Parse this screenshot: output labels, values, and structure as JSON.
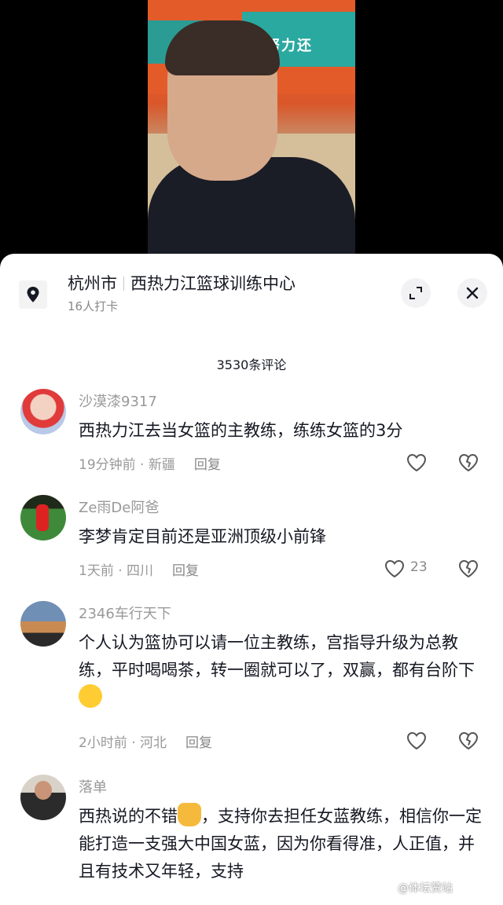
{
  "location": {
    "city": "杭州市",
    "place": "西热力江篮球训练中心",
    "checkins": "16人打卡"
  },
  "video": {
    "banner_text": "努力还"
  },
  "comments_header": {
    "count_label": "3530条评论"
  },
  "comments": [
    {
      "username": "沙漠漆9317",
      "text": "西热力江去当女篮的主教练，练练女篮的3分",
      "time": "19分钟前",
      "region": "新疆",
      "reply": "回复",
      "likes": ""
    },
    {
      "username": "Ze雨De阿爸",
      "text": "李梦肯定目前还是亚洲顶级小前锋",
      "time": "1天前",
      "region": "四川",
      "reply": "回复",
      "likes": "23"
    },
    {
      "username": "2346车行天下",
      "text": "个人认为篮协可以请一位主教练，宫指导升级为总教练，平时喝喝茶，转一圈就可以了，双赢，都有台阶下",
      "time": "2小时前",
      "region": "河北",
      "reply": "回复",
      "likes": ""
    },
    {
      "username": "落单",
      "text_a": "西热说的不错",
      "text_b": "，支持你去担任女蓝教练，相信你一定能打造一支强大中国女蓝，因为你看得准，人正值，并且有技术又年轻，支持",
      "time": "",
      "region": "",
      "reply": "",
      "likes": ""
    }
  ],
  "watermark": "@体坛赞站",
  "icons": {
    "location": "location-pin-icon",
    "expand": "expand-icon",
    "close": "close-icon",
    "like": "heart-outline-icon",
    "dislike": "broken-heart-icon"
  }
}
